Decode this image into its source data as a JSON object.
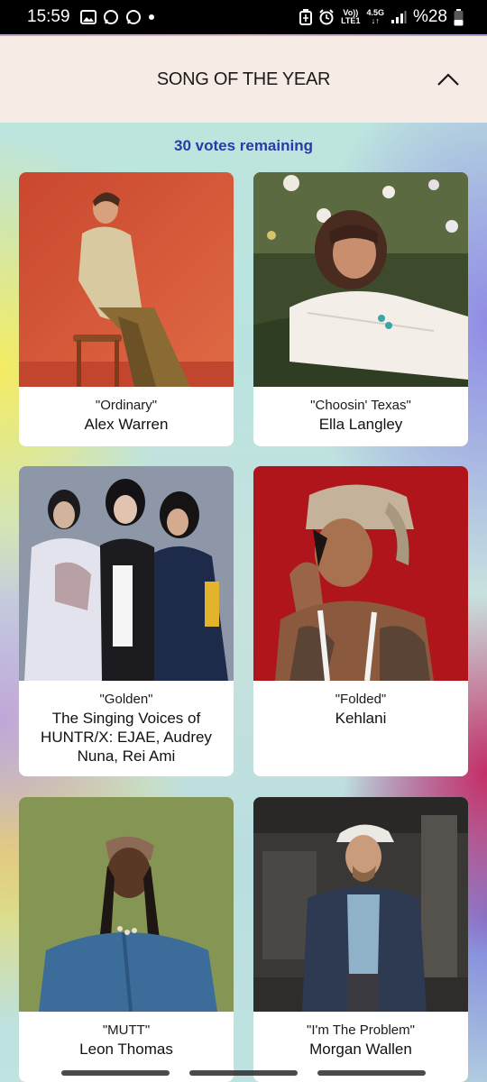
{
  "status_bar": {
    "time": "15:59",
    "network_top": "Vo))",
    "network_bottom": "LTE1",
    "net_speed_top": "4.5G",
    "battery": "%28"
  },
  "section": {
    "title": "SONG OF THE YEAR"
  },
  "votes_remaining": "30 votes remaining",
  "cards": [
    {
      "song": "\"Ordinary\"",
      "artist": "Alex Warren"
    },
    {
      "song": "\"Choosin' Texas\"",
      "artist": "Ella Langley"
    },
    {
      "song": "\"Golden\"",
      "artist": "The Singing Voices of HUNTR/X: EJAE, Audrey Nuna, Rei Ami"
    },
    {
      "song": "\"Folded\"",
      "artist": "Kehlani"
    },
    {
      "song": "\"MUTT\"",
      "artist": "Leon Thomas"
    },
    {
      "song": "\"I'm The Problem\"",
      "artist": "Morgan Wallen"
    }
  ],
  "colors": {
    "votes_text": "#2b3aa8",
    "header_bg": "#f7ebe6"
  }
}
